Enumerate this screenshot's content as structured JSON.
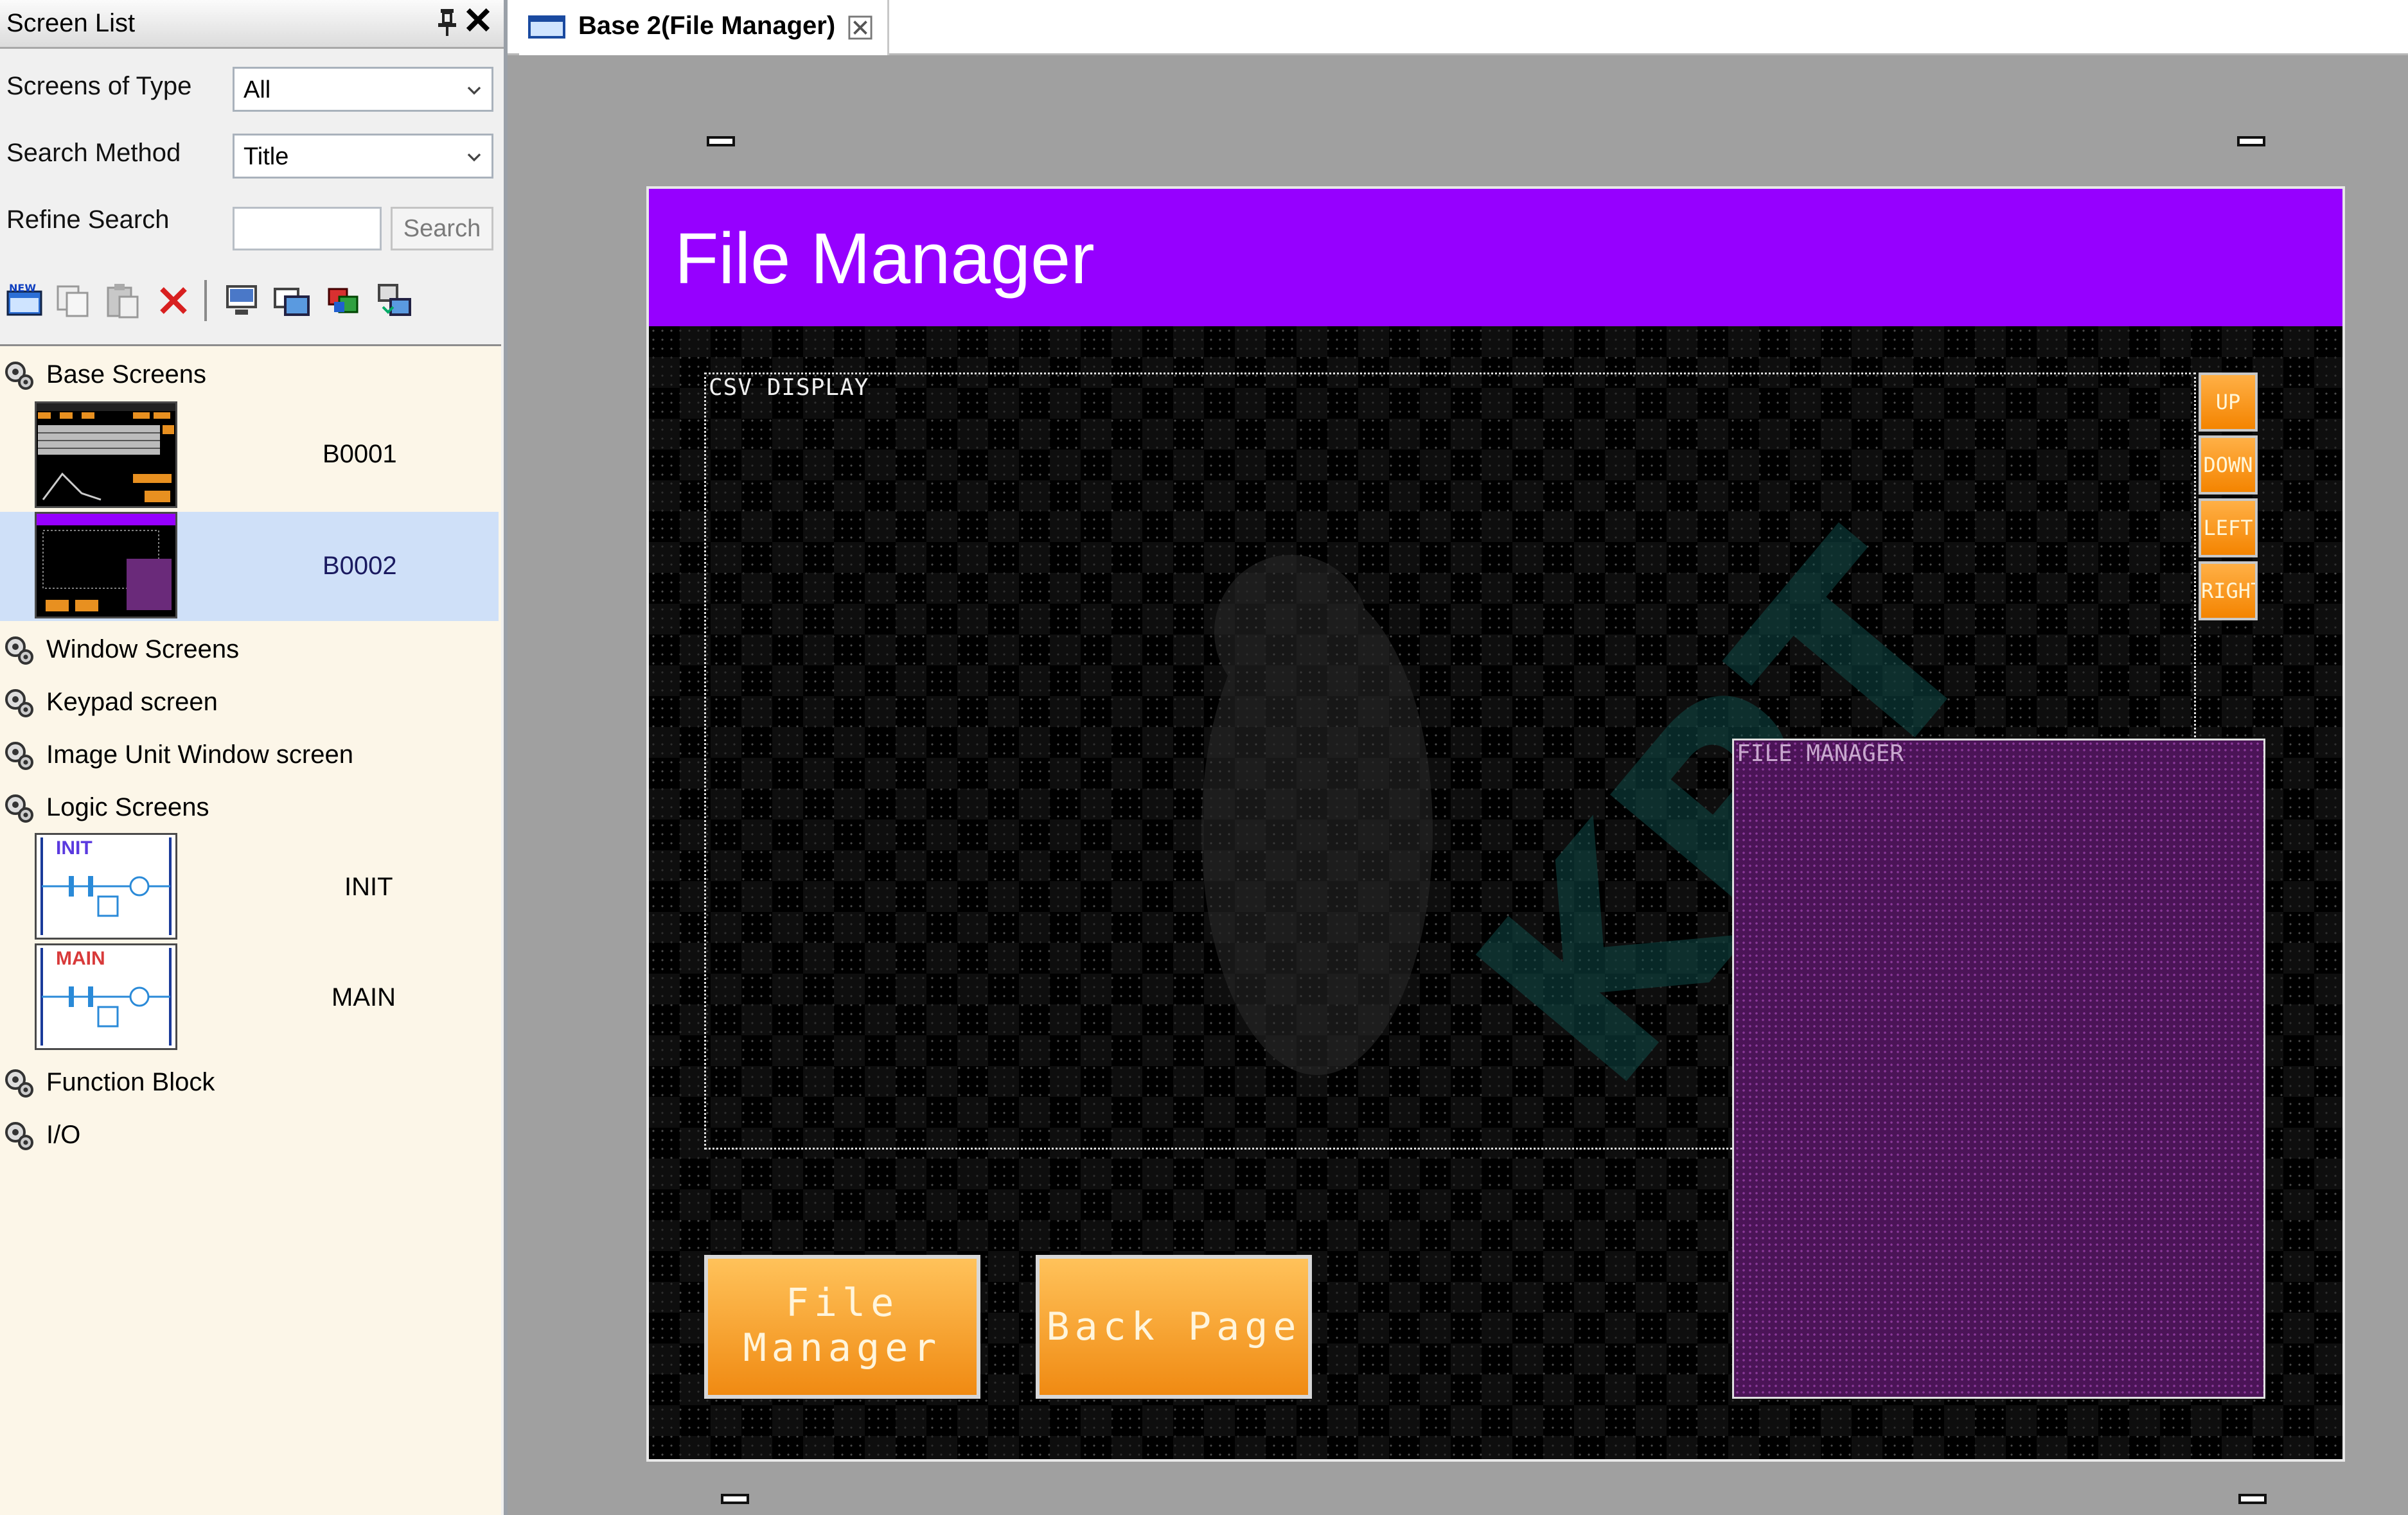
{
  "screen_list": {
    "title": "Screen List",
    "pin_glyph": "⭿",
    "close_glyph": "✕",
    "screens_of_type": {
      "label": "Screens of Type",
      "value": "All"
    },
    "search_method": {
      "label": "Search Method",
      "value": "Title"
    },
    "refine_search": {
      "label": "Refine Search",
      "value": "",
      "button": "Search"
    }
  },
  "toolbar_icons": [
    "new-screen-icon",
    "copy-icon",
    "paste-icon",
    "delete-icon",
    "screen-settings-icon",
    "screen-overlay-icon",
    "screen-color-icon",
    "screen-transfer-icon"
  ],
  "tree": {
    "base_screens": "Base Screens",
    "base_items": [
      {
        "id": "B0001"
      },
      {
        "id": "B0002"
      }
    ],
    "window_screens": "Window Screens",
    "keypad_screen": "Keypad screen",
    "image_unit_window": "Image Unit Window screen",
    "logic_screens": "Logic Screens",
    "logic_items": [
      {
        "id": "INIT",
        "thumb_label": "INIT"
      },
      {
        "id": "MAIN",
        "thumb_label": "MAIN"
      }
    ],
    "function_block": "Function Block",
    "io": "I/O"
  },
  "editor": {
    "tab_title": "Base 2(File Manager)",
    "screen_title": "File Manager",
    "csv_label": "CSV DISPLAY",
    "file_manager_label": "FILE MANAGER",
    "arrow_buttons": [
      "UP",
      "DOWN",
      "LEFT",
      "RIGHT"
    ],
    "file_manager_button": [
      "File",
      "Manager"
    ],
    "back_page_button": "Back Page",
    "watermark": "KPT"
  },
  "colors": {
    "header_purple": "#9600ff",
    "button_orange": "#f48400",
    "fm_overlay": "#4b1457",
    "tree_bg": "#fcf6e8",
    "selected_row": "#cfe0f8"
  }
}
